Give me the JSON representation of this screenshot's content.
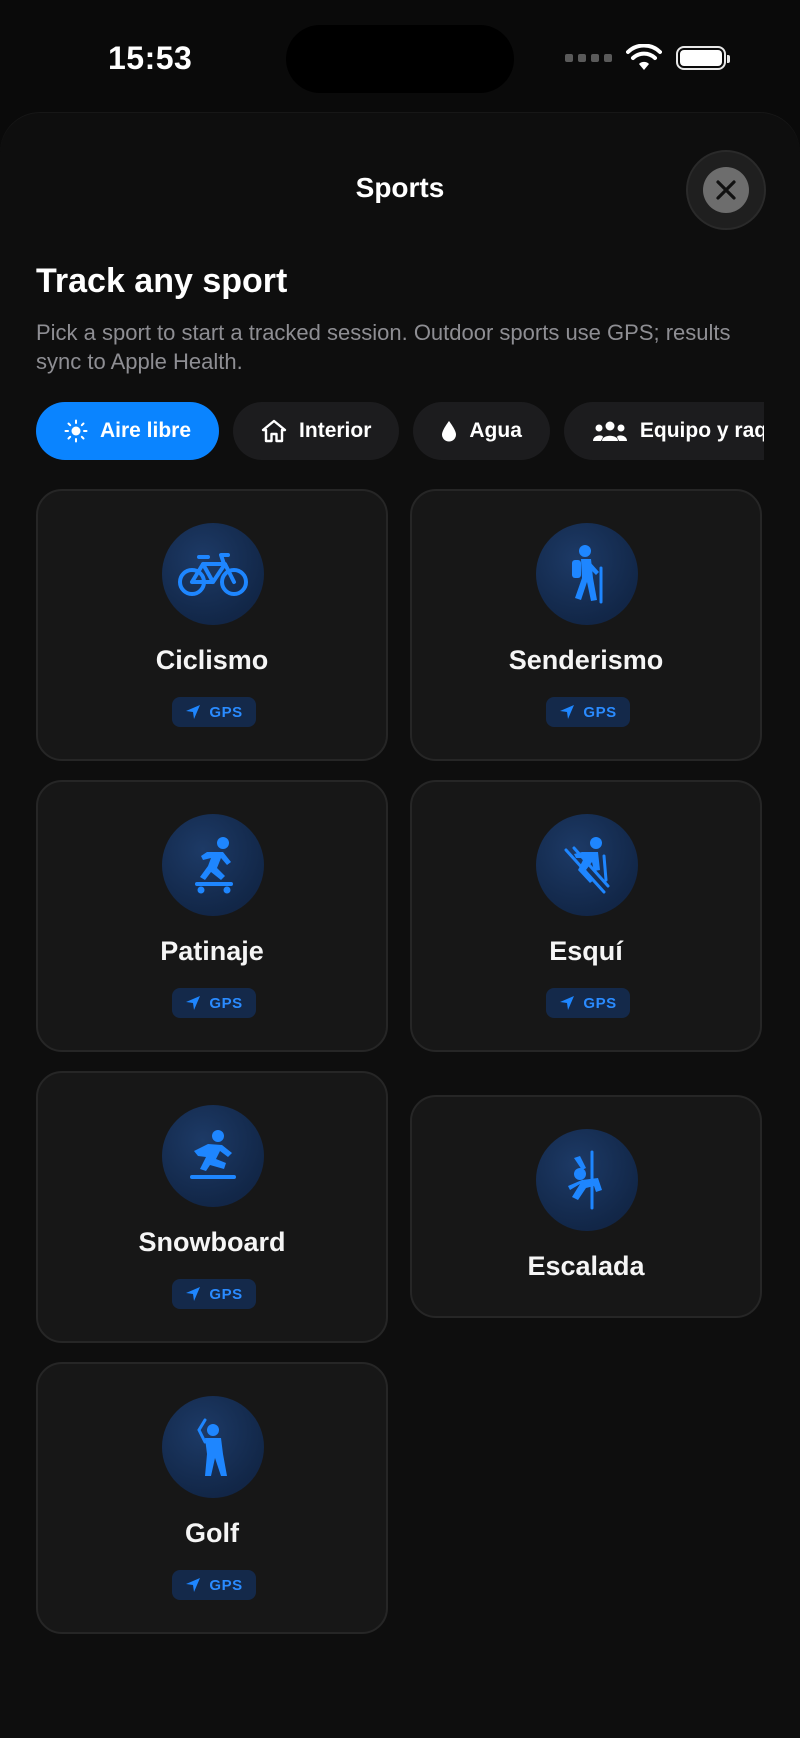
{
  "status_bar": {
    "time": "15:53"
  },
  "sheet": {
    "title": "Sports",
    "heading": "Track any sport",
    "subtitle": "Pick a sport to start a tracked session. Outdoor sports use GPS; results sync to Apple Health."
  },
  "categories": [
    {
      "label": "Aire libre",
      "icon": "sun-icon",
      "selected": true
    },
    {
      "label": "Interior",
      "icon": "house-icon",
      "selected": false
    },
    {
      "label": "Agua",
      "icon": "drop-icon",
      "selected": false
    },
    {
      "label": "Equipo y raq",
      "icon": "people-icon",
      "selected": false
    }
  ],
  "sports": [
    {
      "name": "Ciclismo",
      "icon": "bicycle-icon",
      "badge": "GPS"
    },
    {
      "name": "Senderismo",
      "icon": "hiking-icon",
      "badge": "GPS"
    },
    {
      "name": "Patinaje",
      "icon": "skateboarding-icon",
      "badge": "GPS"
    },
    {
      "name": "Esquí",
      "icon": "skiing-icon",
      "badge": "GPS"
    },
    {
      "name": "Snowboard",
      "icon": "snowboarding-icon",
      "badge": "GPS"
    },
    {
      "name": "Escalada",
      "icon": "climbing-icon",
      "badge": ""
    },
    {
      "name": "Golf",
      "icon": "golf-icon",
      "badge": "GPS"
    }
  ],
  "colors": {
    "accent": "#0a84ff",
    "background": "#0a0a0a",
    "card": "#171717",
    "badge_text": "#2a8bff"
  }
}
